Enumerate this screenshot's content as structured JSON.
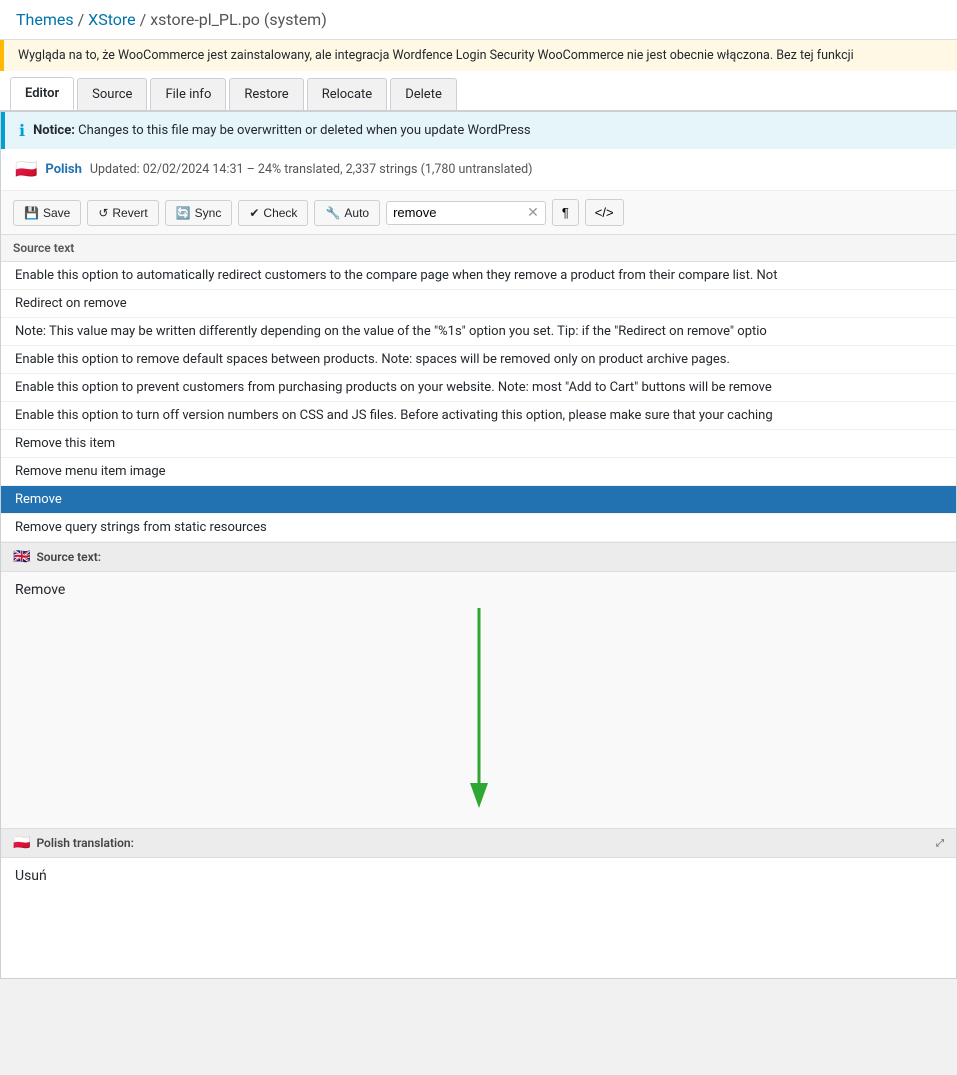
{
  "breadcrumb": {
    "themes_label": "Themes",
    "themes_href": "#",
    "xstore_label": "XStore",
    "xstore_href": "#",
    "file_label": "xstore-pl_PL.po (system)"
  },
  "notice_bar": {
    "text": "Wygląda na to, że WooCommerce jest zainstalowany, ale integracja Wordfence Login Security WooCommerce nie jest obecnie włączona. Bez tej funkcji"
  },
  "tabs": [
    {
      "id": "editor",
      "label": "Editor",
      "active": true
    },
    {
      "id": "source",
      "label": "Source",
      "active": false
    },
    {
      "id": "file-info",
      "label": "File info",
      "active": false
    },
    {
      "id": "restore",
      "label": "Restore",
      "active": false
    },
    {
      "id": "relocate",
      "label": "Relocate",
      "active": false
    },
    {
      "id": "delete",
      "label": "Delete",
      "active": false
    }
  ],
  "info_notice": {
    "icon": "ℹ",
    "bold": "Notice:",
    "text": " Changes to this file may be overwritten or deleted when you update WordPress"
  },
  "language_bar": {
    "flag": "🇵🇱",
    "name": "Polish",
    "meta": "Updated: 02/02/2024 14:31 – 24% translated, 2,337 strings (1,780 untranslated)"
  },
  "toolbar": {
    "save_label": "Save",
    "revert_label": "Revert",
    "sync_label": "Sync",
    "check_label": "Check",
    "auto_label": "Auto",
    "search_value": "remove",
    "search_placeholder": "Search...",
    "paragraph_icon": "¶",
    "code_icon": "<>"
  },
  "source_text_header": "Source text",
  "results": [
    {
      "id": 1,
      "text": "Enable this option to automatically redirect customers to the compare page when they remove a product from their compare list. Not",
      "selected": false
    },
    {
      "id": 2,
      "text": "Redirect on remove",
      "selected": false
    },
    {
      "id": 3,
      "text": "Note: This value may be written differently depending on the value of the \"%1s\" option you set. Tip: if the \"Redirect on remove\" optio",
      "selected": false
    },
    {
      "id": 4,
      "text": "Enable this option to remove default spaces between products. Note: spaces will be removed only on product archive pages.",
      "selected": false
    },
    {
      "id": 5,
      "text": "Enable this option to prevent customers from purchasing products on your website. Note: most \"Add to Cart\" buttons will be remove",
      "selected": false
    },
    {
      "id": 6,
      "text": "Enable this option to turn off version numbers on CSS and JS files. Before activating this option, please make sure that your caching",
      "selected": false
    },
    {
      "id": 7,
      "text": "Remove this item",
      "selected": false
    },
    {
      "id": 8,
      "text": "Remove menu item image",
      "selected": false
    },
    {
      "id": 9,
      "text": "Remove",
      "selected": true
    },
    {
      "id": 10,
      "text": "Remove query strings from static resources",
      "selected": false
    }
  ],
  "source_panel": {
    "flag": "🇬🇧",
    "header": "Source text:",
    "content": "Remove"
  },
  "translation_panel": {
    "flag": "🇵🇱",
    "header": "Polish translation:",
    "content": "Usuń"
  }
}
